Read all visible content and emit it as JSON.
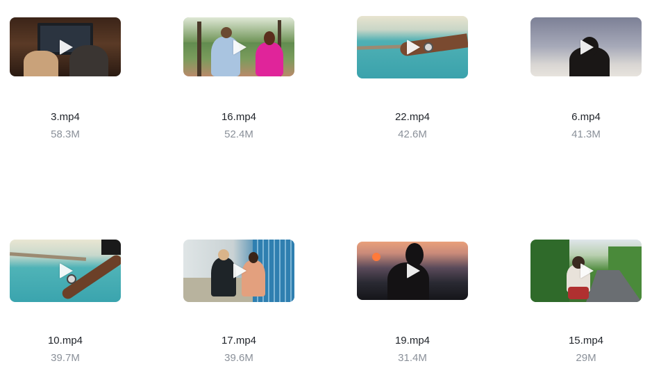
{
  "files": [
    {
      "name": "3.mp4",
      "size": "58.3M",
      "scene": "room-tv"
    },
    {
      "name": "16.mp4",
      "size": "52.4M",
      "scene": "park-couple"
    },
    {
      "name": "22.mp4",
      "size": "42.6M",
      "scene": "sea-hand"
    },
    {
      "name": "6.mp4",
      "size": "41.3M",
      "scene": "silhouette-sky"
    },
    {
      "name": "10.mp4",
      "size": "39.7M",
      "scene": "sea-hand-2"
    },
    {
      "name": "17.mp4",
      "size": "39.6M",
      "scene": "bridge-walk"
    },
    {
      "name": "19.mp4",
      "size": "31.4M",
      "scene": "sunset-silhouette"
    },
    {
      "name": "15.mp4",
      "size": "29M",
      "scene": "road-bike"
    }
  ]
}
